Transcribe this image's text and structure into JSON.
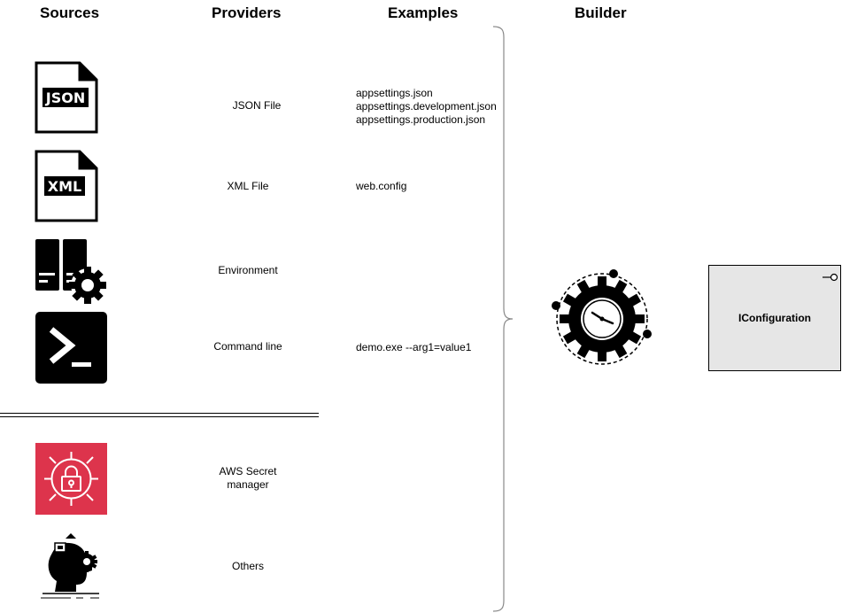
{
  "headers": {
    "sources": "Sources",
    "providers": "Providers",
    "examples": "Examples",
    "builder": "Builder"
  },
  "rows": [
    {
      "icon": "json-file-icon",
      "icon_text": "JSON",
      "provider": "JSON File",
      "examples": [
        "appsettings.json",
        "appsettings.development.json",
        "appsettings.production.json"
      ]
    },
    {
      "icon": "xml-file-icon",
      "icon_text": "XML",
      "provider": "XML File",
      "examples": [
        "web.config"
      ]
    },
    {
      "icon": "server-gear-icon",
      "provider": "Environment",
      "examples": []
    },
    {
      "icon": "terminal-icon",
      "provider": "Command line",
      "examples": [
        "demo.exe --arg1=value1"
      ]
    },
    {
      "icon": "aws-secrets-manager-icon",
      "provider_lines": [
        "AWS Secret",
        "manager"
      ],
      "examples": []
    },
    {
      "icon": "head-gear-icon",
      "provider": "Others",
      "examples": []
    }
  ],
  "builder_icon": "gear-clock-icon",
  "output": {
    "label": "IConfiguration",
    "icon": "lollipop-interface-icon"
  },
  "colors": {
    "aws_red": "#DD344C",
    "box_fill": "#E6E6E6",
    "icon_black": "#000000"
  }
}
